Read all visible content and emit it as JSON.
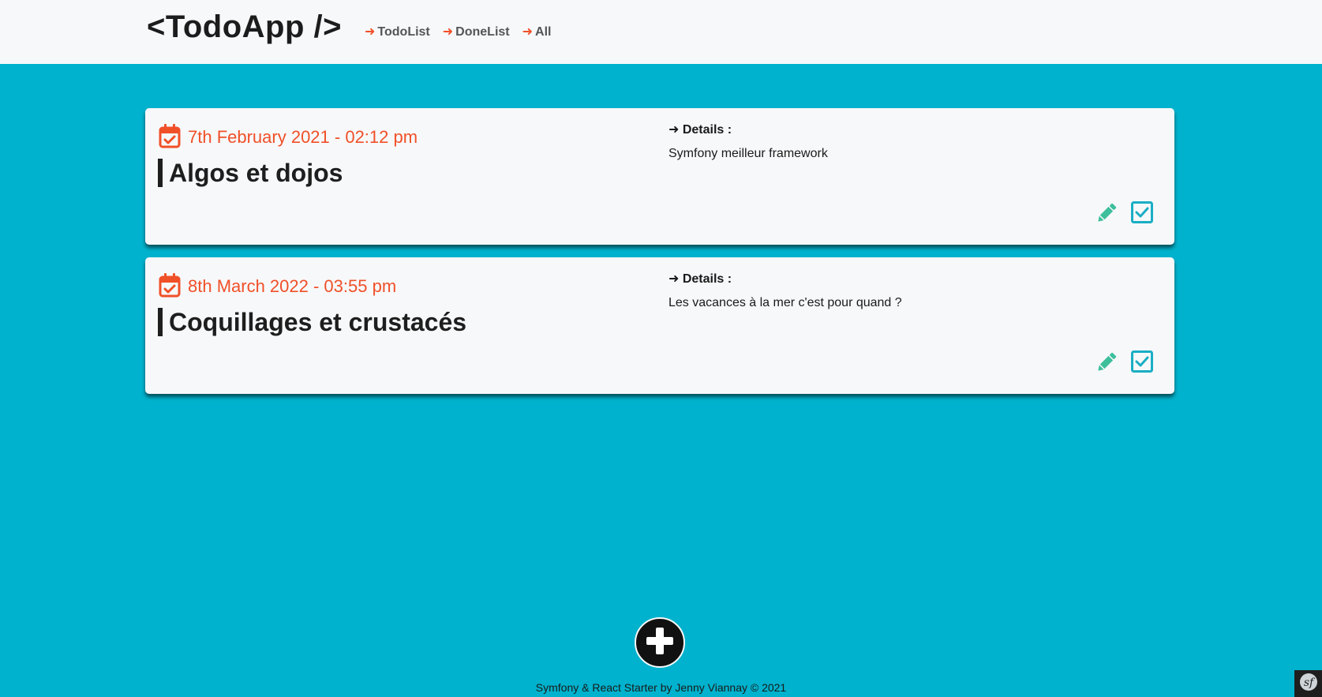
{
  "header": {
    "brand": "<TodoApp />",
    "nav": [
      {
        "arrow": "➜",
        "label": "TodoList"
      },
      {
        "arrow": "➜",
        "label": "DoneList"
      },
      {
        "arrow": "➜",
        "label": "All"
      }
    ]
  },
  "todos": [
    {
      "date": "7th February 2021 - 02:12 pm",
      "title": "Algos et dojos",
      "details_label": "➜ Details :",
      "details": "Symfony meilleur framework"
    },
    {
      "date": "8th March 2022 - 03:55 pm",
      "title": "Coquillages et crustacés",
      "details_label": "➜ Details :",
      "details": "Les vacances à la mer c'est pour quand ?"
    }
  ],
  "icons": {
    "calendar": "calendar-check-icon",
    "edit": "pencil-icon",
    "done": "check-square-icon",
    "add": "plus-icon",
    "symfony": "symfony-icon"
  },
  "colors": {
    "background": "#00b2cd",
    "accent": "#f05028",
    "edit": "#3dbf9c",
    "check": "#1aaec4",
    "card": "#f7f8fa"
  },
  "footer": {
    "text": "Symfony & React Starter by Jenny Viannay © 2021"
  }
}
